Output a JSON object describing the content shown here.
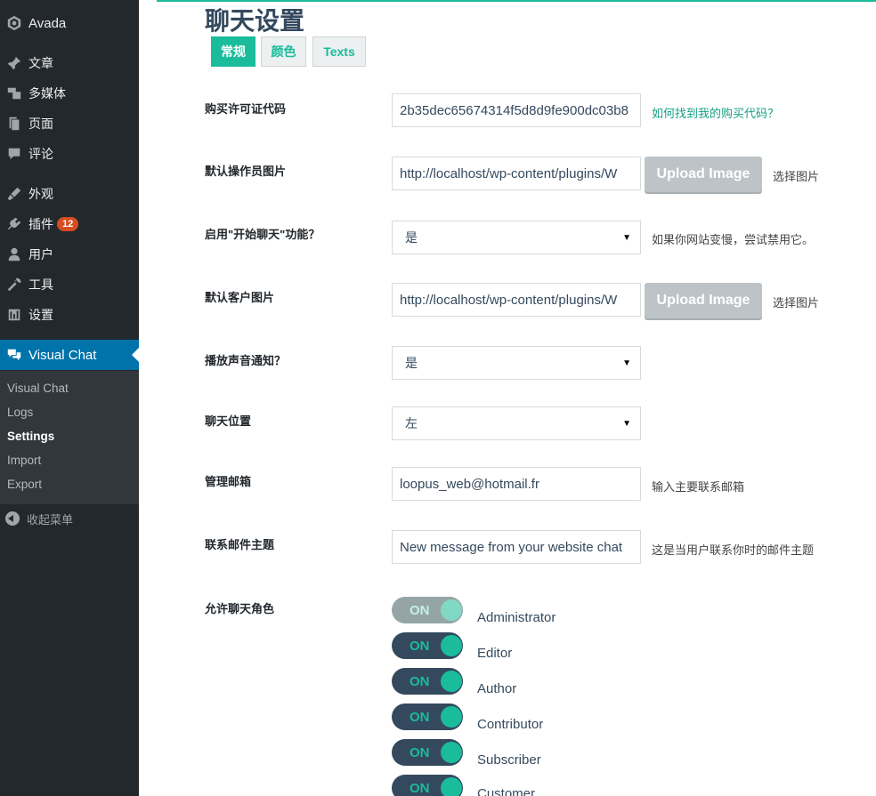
{
  "sidebar": {
    "site_name": "Avada",
    "items": [
      {
        "label": "文章",
        "icon": "pin-icon"
      },
      {
        "label": "多媒体",
        "icon": "media-icon"
      },
      {
        "label": "页面",
        "icon": "page-icon"
      },
      {
        "label": "评论",
        "icon": "comment-icon"
      },
      {
        "label": "外观",
        "icon": "appearance-icon"
      },
      {
        "label": "插件",
        "icon": "plugin-icon",
        "badge": "12"
      },
      {
        "label": "用户",
        "icon": "user-icon"
      },
      {
        "label": "工具",
        "icon": "wrench-icon"
      },
      {
        "label": "设置",
        "icon": "settings-icon"
      }
    ],
    "active_plugin": "Visual Chat",
    "submenu": [
      "Visual Chat",
      "Logs",
      "Settings",
      "Import",
      "Export"
    ],
    "current_submenu": "Settings",
    "collapse_label": "收起菜单"
  },
  "page": {
    "title": "聊天设置",
    "tabs": [
      "常规",
      "颜色",
      "Texts"
    ],
    "active_tab": "常规"
  },
  "form": {
    "purchase_code": {
      "label": "购买许可证代码",
      "value": "2b35dec65674314f5d8d9fe900dc03b8",
      "help": "如何找到我的购买代码？"
    },
    "operator_image": {
      "label": "默认操作员图片",
      "value": "http://localhost/wp-content/plugins/W",
      "button": "Upload Image",
      "help": "选择图片"
    },
    "start_chat": {
      "label": "启用\"开始聊天\"功能？",
      "value": "是",
      "help": "如果你网站变慢，尝试禁用它。"
    },
    "customer_image": {
      "label": "默认客户图片",
      "value": "http://localhost/wp-content/plugins/W",
      "button": "Upload Image",
      "help": "选择图片"
    },
    "sound_notification": {
      "label": "播放声音通知？",
      "value": "是"
    },
    "chat_position": {
      "label": "聊天位置",
      "value": "左"
    },
    "admin_email": {
      "label": "管理邮箱",
      "value": "loopus_web@hotmail.fr",
      "help": "输入主要联系邮箱"
    },
    "email_subject": {
      "label": "联系邮件主题",
      "value": "New message from your website chat",
      "help": "这是当用户联系你时的邮件主题"
    },
    "roles": {
      "label": "允许聊天角色",
      "items": [
        {
          "name": "Administrator",
          "state": "ON"
        },
        {
          "name": "Editor",
          "state": "ON"
        },
        {
          "name": "Author",
          "state": "ON"
        },
        {
          "name": "Contributor",
          "state": "ON"
        },
        {
          "name": "Subscriber",
          "state": "ON"
        },
        {
          "name": "Customer",
          "state": "ON"
        }
      ]
    }
  }
}
